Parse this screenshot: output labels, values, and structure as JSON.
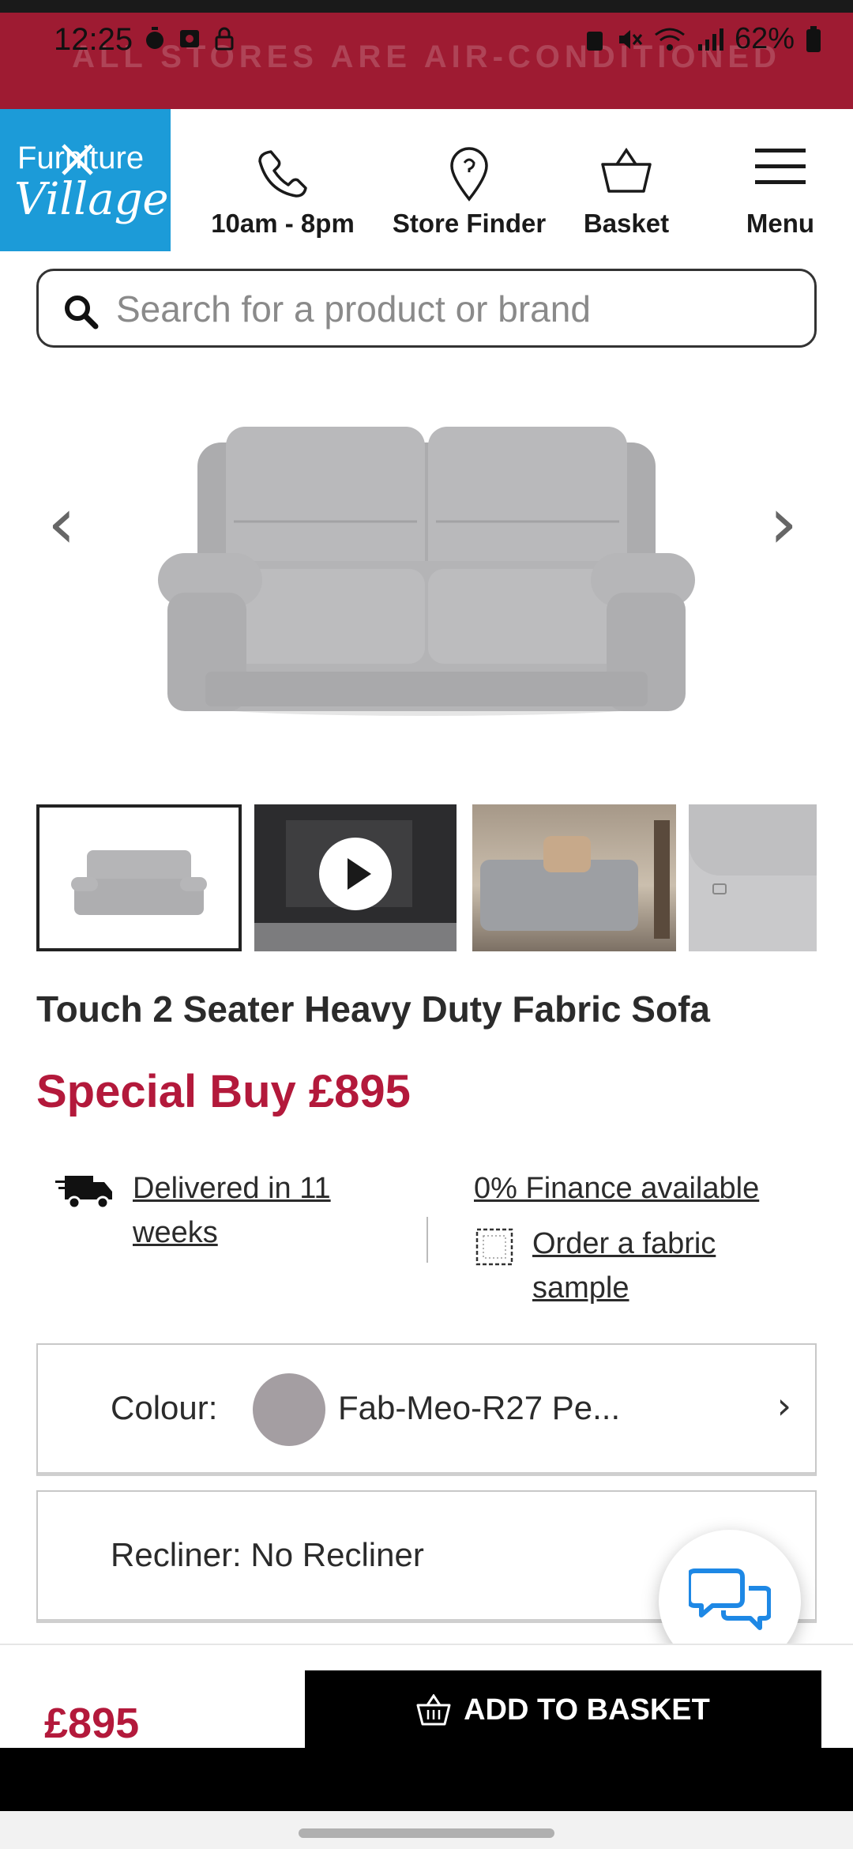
{
  "status_bar": {
    "time": "12:25",
    "battery": "62%"
  },
  "promo_banner": "ALL STORES ARE AIR-CONDITIONED",
  "logo": {
    "line1": "Furniture",
    "line2": "Village"
  },
  "header": {
    "hours_label": "10am - 8pm",
    "store_finder_label": "Store Finder",
    "basket_label": "Basket",
    "menu_label": "Menu"
  },
  "search": {
    "placeholder": "Search for a product or brand"
  },
  "product": {
    "title": "Touch 2 Seater Heavy Duty Fabric Sofa",
    "price_label": "Special Buy £895",
    "delivery_line1": "Delivered in 11",
    "delivery_line2": "weeks",
    "finance": "0% Finance available",
    "fabric_line1": "Order a fabric",
    "fabric_line2": "sample"
  },
  "options": {
    "colour_label": "Colour:",
    "colour_value": "Fab-Meo-R27 Pe...",
    "colour_hex": "#a49ea2",
    "recliner_label": "Recliner: No Recliner"
  },
  "bottom": {
    "price": "£895",
    "add_label": "ADD TO BASKET"
  },
  "colors": {
    "brand_red": "#b3193b",
    "banner_red": "#9e1b32",
    "logo_blue": "#1c9bd8"
  },
  "icons": [
    "phone-icon",
    "location-pin-icon",
    "basket-icon",
    "menu-icon",
    "search-icon",
    "chevron-left-icon",
    "chevron-right-icon",
    "play-icon",
    "truck-icon",
    "fabric-sample-icon",
    "chevron-right-icon",
    "chat-icon",
    "basket-icon"
  ]
}
